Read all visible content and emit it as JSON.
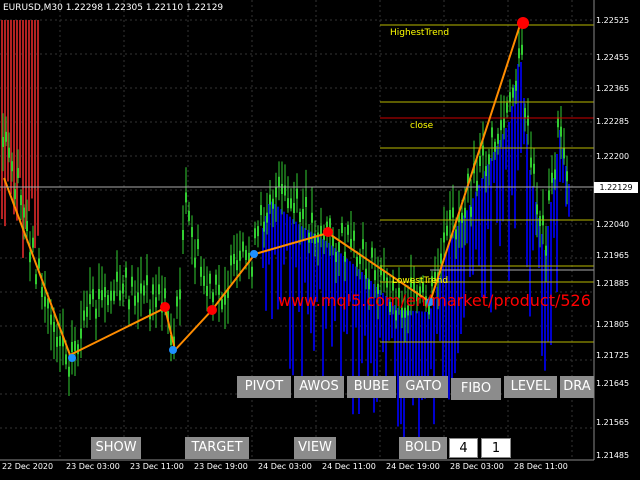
{
  "symbol_header": "EURUSD,M30  1.22298 1.22305 1.22110 1.22129",
  "price_axis": [
    "1.22525",
    "1.22455",
    "1.22365",
    "1.22285",
    "1.22200",
    "1.22120",
    "1.22040",
    "1.21965",
    "1.21885",
    "1.21805",
    "1.21725",
    "1.21645",
    "1.21565",
    "1.21485"
  ],
  "current_price": "1.22129",
  "date_axis": [
    "22 Dec 2020",
    "23 Dec 03:00",
    "23 Dec 11:00",
    "23 Dec 19:00",
    "24 Dec 03:00",
    "24 Dec 11:00",
    "24 Dec 19:00",
    "28 Dec 03:00",
    "28 Dec 11:00"
  ],
  "annotations": {
    "highest": "HighestTrend",
    "close": "close",
    "lowest": "LowestTrend"
  },
  "watermark": "www.mql5.com/en/market/product/526",
  "buttons_row1": [
    "PIVOT",
    "AWOS",
    "BUBE",
    "GATO",
    "FIBO",
    "LEVEL",
    "DRA"
  ],
  "buttons_row2": [
    "SHOW",
    "TARGET",
    "VIEW",
    "BOLD"
  ],
  "inputs": {
    "bold_value": "4",
    "count_value": "1"
  },
  "colors": {
    "background": "#000000",
    "bull": "#32cd32",
    "trend": "#ff8c00",
    "pivot": "#ff0000",
    "histogram": "#0000cd",
    "level_line": "#ffff00",
    "close_line": "#ff0000",
    "grid": "#555555"
  }
}
